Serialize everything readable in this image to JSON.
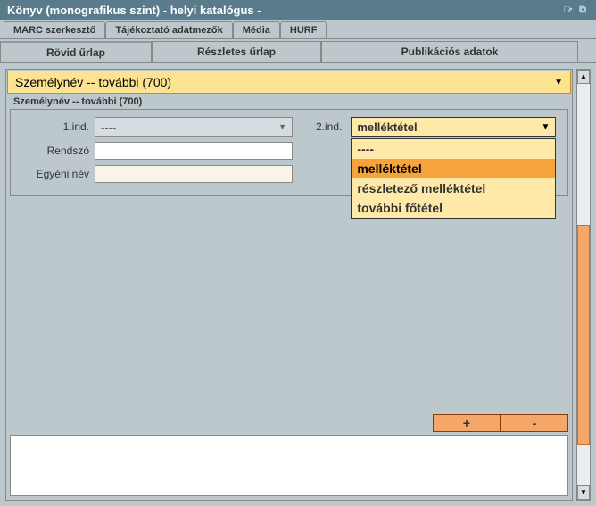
{
  "window": {
    "title": "Könyv (monografikus szint) - helyi katalógus -"
  },
  "tabs1": [
    {
      "label": "MARC szerkesztő"
    },
    {
      "label": "Tájékoztató adatmezők"
    },
    {
      "label": "Média"
    },
    {
      "label": "HURF"
    }
  ],
  "tabs2": [
    {
      "label": "Rövid űrlap"
    },
    {
      "label": "Részletes űrlap"
    },
    {
      "label": "Publikációs adatok"
    }
  ],
  "section": {
    "title": "Személynév -- további (700)"
  },
  "fieldset": {
    "legend": "Személynév -- további (700)"
  },
  "form": {
    "ind1_label": "1.ind.",
    "ind1_value": "----",
    "ind2_label": "2.ind.",
    "ind2_value": "melléktétel",
    "rendszo_label": "Rendszó",
    "egyeninev_label": "Egyéni név"
  },
  "dropdown": {
    "opt0": "----",
    "opt1": "melléktétel",
    "opt2": "részletező melléktétel",
    "opt3": "további főtétel"
  },
  "buttons": {
    "plus": "+",
    "minus": "-"
  }
}
